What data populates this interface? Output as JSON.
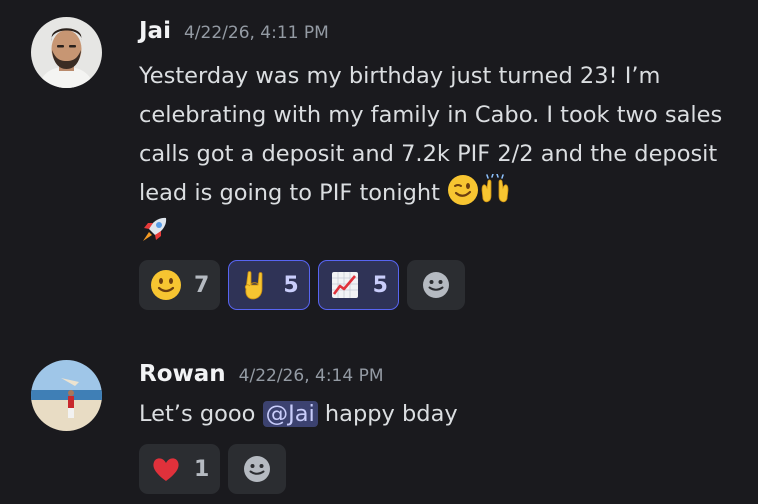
{
  "messages": [
    {
      "author": "Jai",
      "timestamp": "4/22/26, 4:11 PM",
      "text": "Yesterday was my birthday just turned 23! I’m celebrating with my family in Cabo. I took two sales calls got a deposit and 7.2k PIF 2/2 and the deposit lead is going to PIF tonight",
      "trailing_emojis": [
        "winking-face",
        "raising-hands",
        "rocket"
      ],
      "reactions": [
        {
          "emoji": "slightly-smiling-face",
          "count": "7",
          "active": false
        },
        {
          "emoji": "sign-of-the-horns",
          "count": "5",
          "active": true
        },
        {
          "emoji": "chart-increasing",
          "count": "5",
          "active": true
        }
      ]
    },
    {
      "author": "Rowan",
      "timestamp": "4/22/26, 4:14 PM",
      "text_before": "Let’s gooo",
      "mention": "@Jai",
      "text_after": "happy bday",
      "reactions": [
        {
          "emoji": "red-heart",
          "count": "1",
          "active": false
        }
      ]
    }
  ],
  "colors": {
    "background": "#1a1a1e",
    "mention_bg": "#3c4270",
    "reaction_active_border": "#5865f2"
  }
}
